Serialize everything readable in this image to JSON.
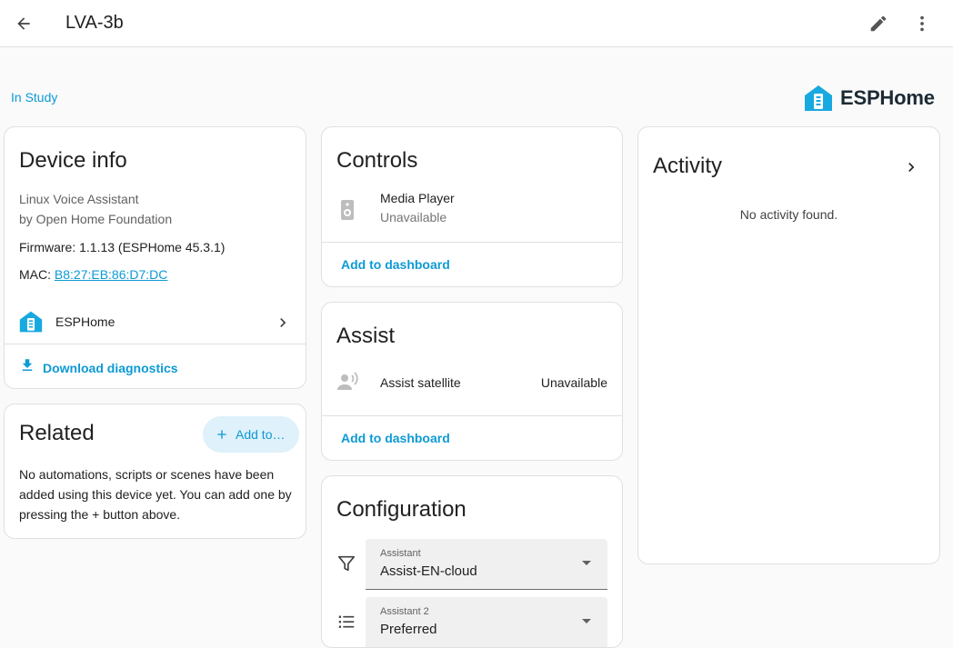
{
  "header": {
    "title": "LVA-3b",
    "back_icon": "arrow-left-icon",
    "edit_icon": "pencil-icon",
    "more_icon": "dots-vertical-icon"
  },
  "area": {
    "label": "In Study"
  },
  "brand": {
    "name": "ESPHome",
    "icon": "esphome-logo",
    "color": "#18a9e0"
  },
  "device_info": {
    "title": "Device info",
    "model": "Linux Voice Assistant",
    "manufacturer": "by Open Home Foundation",
    "firmware": "Firmware: 1.1.13 (ESPHome 45.3.1)",
    "mac_label": "MAC: ",
    "mac_value": "B8:27:EB:86:D7:DC",
    "integration_label": "ESPHome",
    "download_label": "Download diagnostics"
  },
  "related": {
    "title": "Related",
    "add_label": "Add to…",
    "message": "No automations, scripts or scenes have been added using this device yet. You can add one by pressing the + button above."
  },
  "controls": {
    "title": "Controls",
    "entity_name": "Media Player",
    "entity_state": "Unavailable",
    "add_label": "Add to dashboard"
  },
  "assist": {
    "title": "Assist",
    "entity_name": "Assist satellite",
    "entity_state": "Unavailable",
    "add_label": "Add to dashboard"
  },
  "configuration": {
    "title": "Configuration",
    "selects": [
      {
        "label": "Assistant",
        "value": "Assist-EN-cloud",
        "icon": "filter-icon"
      },
      {
        "label": "Assistant 2",
        "value": "Preferred",
        "icon": "format-list-icon"
      }
    ]
  },
  "activity": {
    "title": "Activity",
    "empty": "No activity found."
  },
  "colors": {
    "accent": "#0d9ad5",
    "background": "#fafafa",
    "card": "#ffffff"
  }
}
